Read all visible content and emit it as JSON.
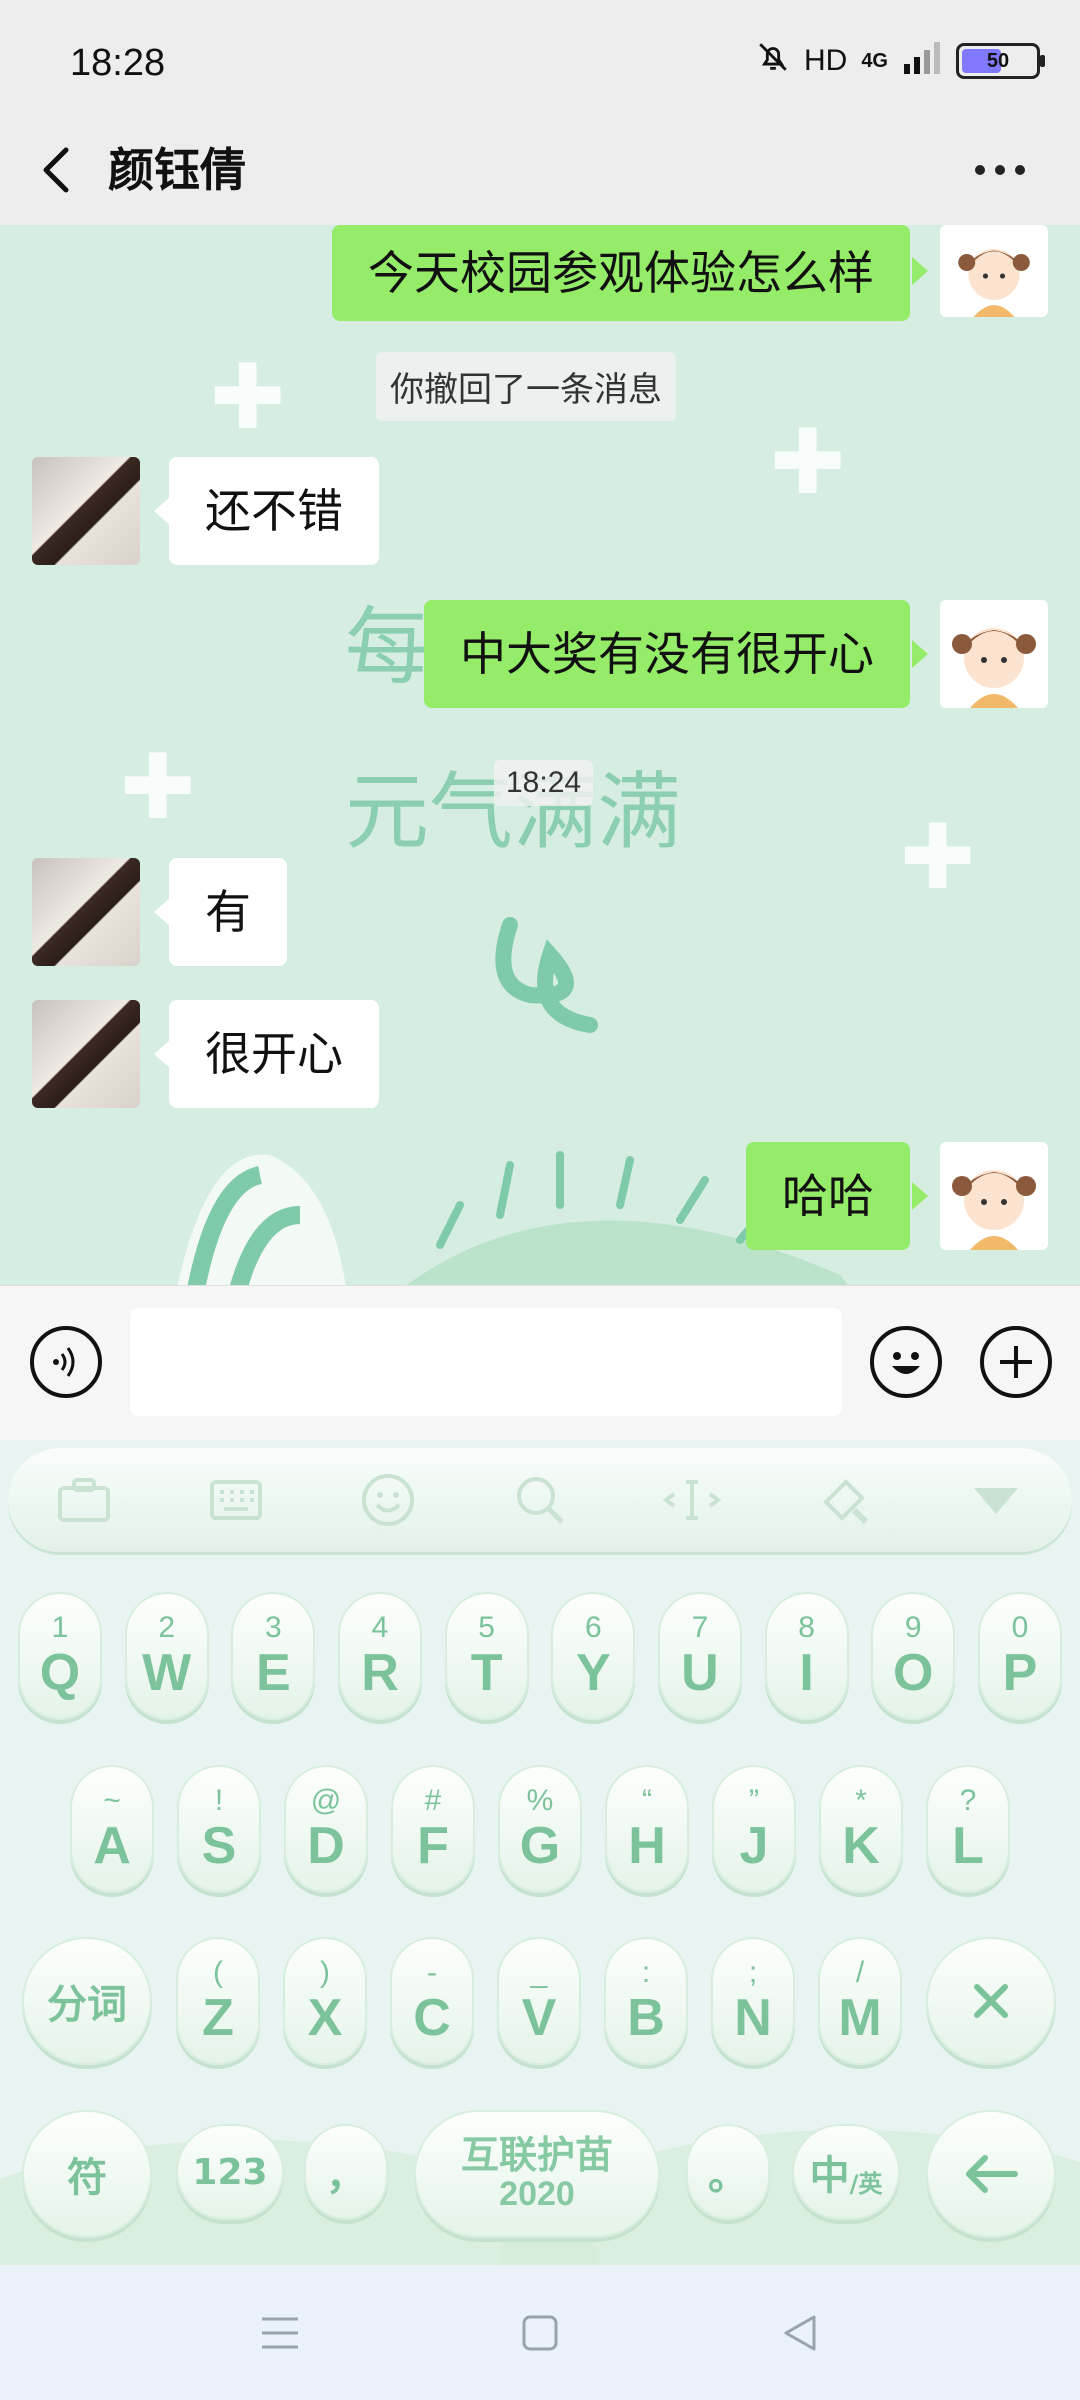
{
  "status_bar": {
    "time": "18:28",
    "hd": "HD",
    "network": "4G",
    "battery": "50"
  },
  "header": {
    "contact_name": "颜钰倩"
  },
  "chat": {
    "messages": [
      {
        "from": "me",
        "text": "今天校园参观体验怎么样"
      },
      {
        "type": "system",
        "text": "你撤回了一条消息"
      },
      {
        "from": "her",
        "text": "还不错"
      },
      {
        "from": "me",
        "text": "中大奖有没有很开心"
      },
      {
        "type": "timestamp",
        "text": "18:24"
      },
      {
        "from": "her",
        "text": "有"
      },
      {
        "from": "her",
        "text": "很开心"
      },
      {
        "from": "me",
        "text": "哈哈"
      }
    ],
    "wallpaper_text": [
      "每",
      "元气满满"
    ]
  },
  "input_bar": {
    "value": ""
  },
  "keyboard": {
    "toolbar_icons": [
      "briefcase-icon",
      "keyboard-icon",
      "emoji-icon",
      "search-icon",
      "cursor-icon",
      "brush-icon",
      "collapse-icon"
    ],
    "row1": [
      {
        "sub": "1",
        "main": "Q"
      },
      {
        "sub": "2",
        "main": "W"
      },
      {
        "sub": "3",
        "main": "E"
      },
      {
        "sub": "4",
        "main": "R"
      },
      {
        "sub": "5",
        "main": "T"
      },
      {
        "sub": "6",
        "main": "Y"
      },
      {
        "sub": "7",
        "main": "U"
      },
      {
        "sub": "8",
        "main": "I"
      },
      {
        "sub": "9",
        "main": "O"
      },
      {
        "sub": "0",
        "main": "P"
      }
    ],
    "row2": [
      {
        "sub": "~",
        "main": "A"
      },
      {
        "sub": "!",
        "main": "S"
      },
      {
        "sub": "@",
        "main": "D"
      },
      {
        "sub": "#",
        "main": "F"
      },
      {
        "sub": "%",
        "main": "G"
      },
      {
        "sub": "“",
        "main": "H"
      },
      {
        "sub": "”",
        "main": "J"
      },
      {
        "sub": "*",
        "main": "K"
      },
      {
        "sub": "?",
        "main": "L"
      }
    ],
    "row3": [
      {
        "sub": "(",
        "main": "Z"
      },
      {
        "sub": ")",
        "main": "X"
      },
      {
        "sub": "-",
        "main": "C"
      },
      {
        "sub": "_",
        "main": "V"
      },
      {
        "sub": ":",
        "main": "B"
      },
      {
        "sub": ";",
        "main": "N"
      },
      {
        "sub": "/",
        "main": "M"
      }
    ],
    "segment_key": "分词",
    "symbol_key": "符",
    "number_key": "123",
    "comma_key": "，",
    "space_banner": {
      "line1": "互联护苗",
      "line2": "2020"
    },
    "period_key": "。",
    "lang_key_main": "中",
    "lang_key_sub": "/英"
  }
}
